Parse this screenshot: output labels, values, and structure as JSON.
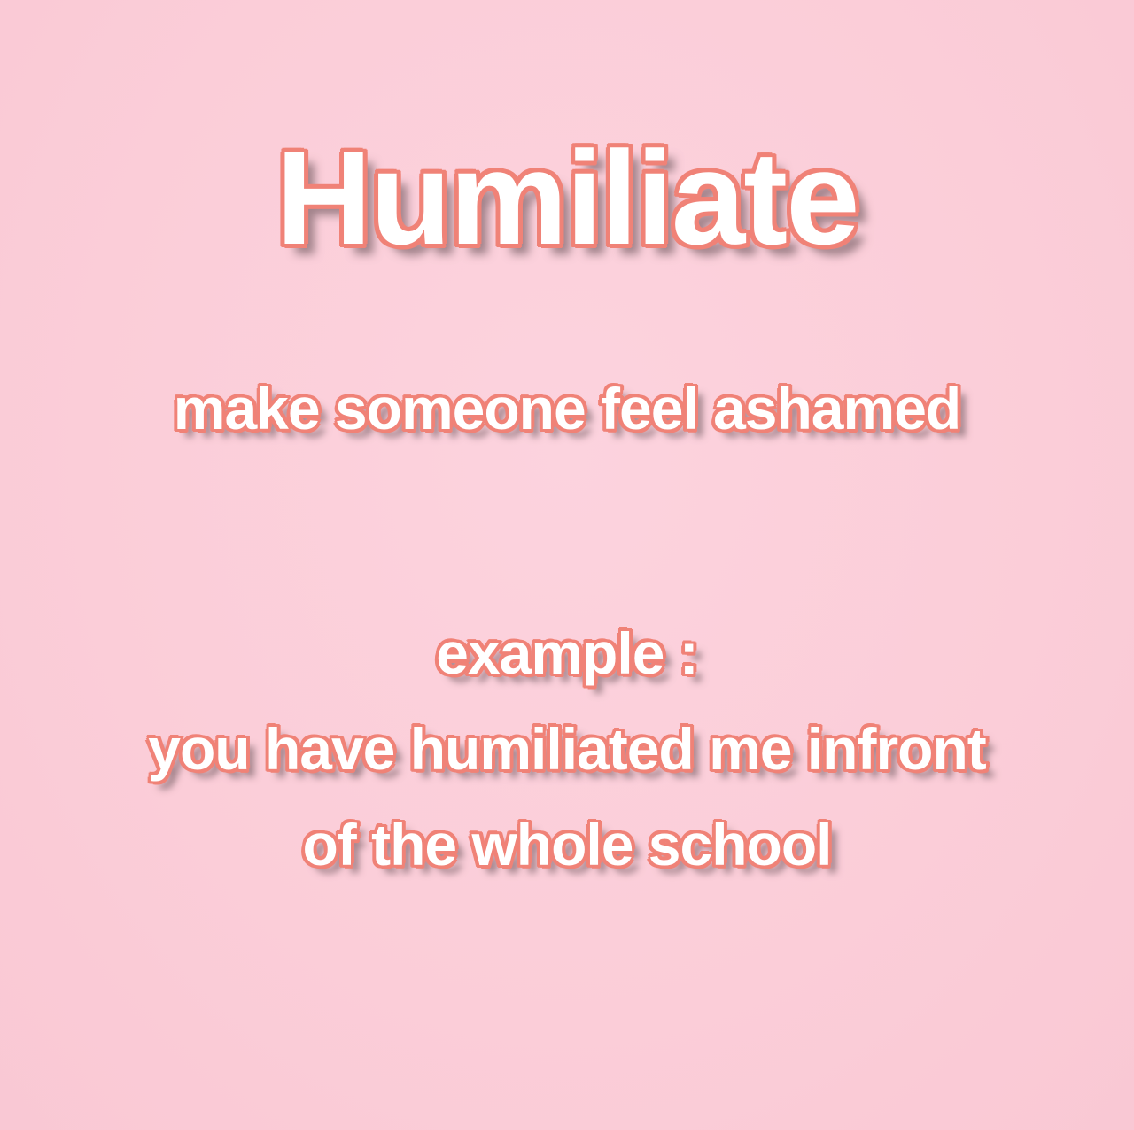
{
  "card": {
    "title": "Humiliate",
    "definition": "make someone feel ashamed",
    "example_label": "example :",
    "example_line_1": "you have humiliated me infront",
    "example_line_2": "of the whole school"
  },
  "colors": {
    "background": "#fbcdd9",
    "text_fill": "#ffffff",
    "text_outline": "#f08277"
  }
}
